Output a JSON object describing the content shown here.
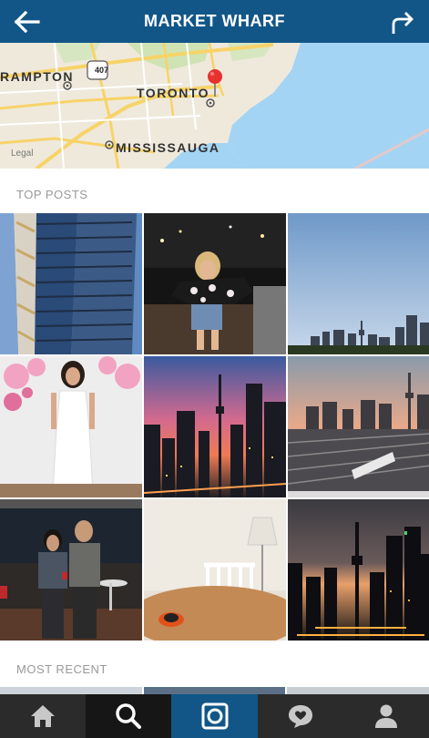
{
  "header": {
    "title": "MARKET WHARF",
    "back_icon": "back-arrow-icon",
    "share_icon": "share-arrow-icon",
    "background_color": "#125688"
  },
  "map": {
    "labels": {
      "brampton": "RAMPTON",
      "toronto": "TORONTO",
      "mississauga": "MISSISSAUGA",
      "highway": "407",
      "legal": "Legal"
    },
    "pin_icon": "map-pin-icon"
  },
  "sections": {
    "top_posts": "TOP POSTS",
    "most_recent": "MOST RECENT"
  },
  "top_posts": [
    {
      "name": "post-condo-tower"
    },
    {
      "name": "post-woman-balcony-night"
    },
    {
      "name": "post-skyline-blue-sky"
    },
    {
      "name": "post-woman-white-dress"
    },
    {
      "name": "post-sunset-cn-tower"
    },
    {
      "name": "post-skyline-railway"
    },
    {
      "name": "post-couple-party"
    },
    {
      "name": "post-toy-car-table"
    },
    {
      "name": "post-skyline-dusk"
    }
  ],
  "tabbar": {
    "items": [
      {
        "name": "tab-home",
        "icon": "home-icon"
      },
      {
        "name": "tab-search",
        "icon": "search-icon",
        "active": true
      },
      {
        "name": "tab-camera",
        "icon": "camera-icon"
      },
      {
        "name": "tab-activity",
        "icon": "heart-bubble-icon"
      },
      {
        "name": "tab-profile",
        "icon": "profile-icon"
      }
    ]
  }
}
